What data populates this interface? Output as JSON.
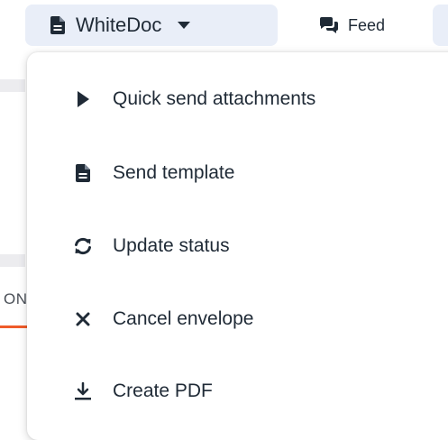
{
  "toolbar": {
    "whitedoc": {
      "label": "WhiteDoc",
      "icon": "document-icon",
      "caret": "caret-down-icon"
    },
    "feed": {
      "label": "Feed",
      "icon": "chat-bubbles-icon"
    }
  },
  "background": {
    "partial_label": "ON"
  },
  "menu": {
    "items": [
      {
        "label": "Quick send attachments",
        "icon": "play-icon"
      },
      {
        "label": "Send template",
        "icon": "document-icon"
      },
      {
        "label": "Update status",
        "icon": "refresh-icon"
      },
      {
        "label": "Cancel envelope",
        "icon": "close-icon"
      },
      {
        "label": "Create PDF",
        "icon": "download-icon"
      }
    ]
  },
  "colors": {
    "accent": "#ef5b2a",
    "tab_bg": "#e9eef8",
    "text": "#1f2a36"
  }
}
